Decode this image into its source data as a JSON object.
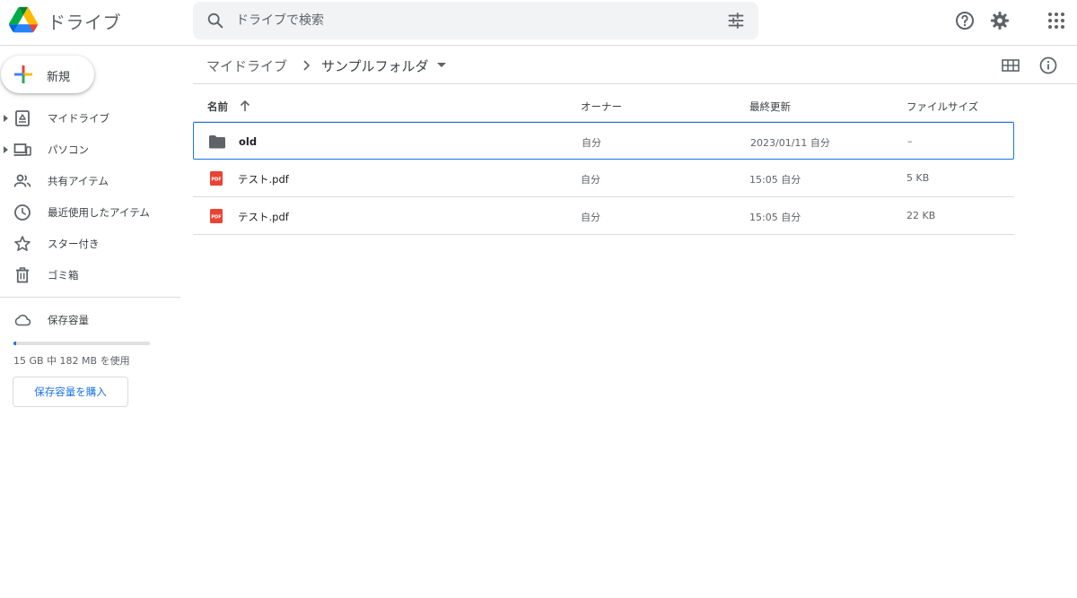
{
  "app": {
    "title": "ドライブ"
  },
  "search": {
    "placeholder": "ドライブで検索"
  },
  "sidebar": {
    "new_label": "新規",
    "items": [
      {
        "label": "マイドライブ",
        "icon": "my-drive-icon"
      },
      {
        "label": "パソコン",
        "icon": "computers-icon"
      },
      {
        "label": "共有アイテム",
        "icon": "shared-icon"
      },
      {
        "label": "最近使用したアイテム",
        "icon": "recent-icon"
      },
      {
        "label": "スター付き",
        "icon": "star-icon"
      },
      {
        "label": "ゴミ箱",
        "icon": "trash-icon"
      }
    ],
    "storage_label": "保存容量",
    "storage_text": "15 GB 中 182 MB を使用",
    "storage_used_fraction": 0.012,
    "buy_label": "保存容量を購入"
  },
  "breadcrumb": {
    "root": "マイドライブ",
    "current": "サンプルフォルダ"
  },
  "table": {
    "headers": {
      "name": "名前",
      "owner": "オーナー",
      "modified": "最終更新",
      "size": "ファイルサイズ"
    },
    "rows": [
      {
        "type": "folder",
        "name": "old",
        "owner": "自分",
        "modified": "2023/01/11 自分",
        "size": "–",
        "selected": true
      },
      {
        "type": "pdf",
        "name": "テスト.pdf",
        "owner": "自分",
        "modified": "15:05 自分",
        "size": "5 KB",
        "selected": false
      },
      {
        "type": "pdf",
        "name": "テスト.pdf",
        "owner": "自分",
        "modified": "15:05 自分",
        "size": "22 KB",
        "selected": false
      }
    ]
  },
  "colors": {
    "accent": "#1a73e8",
    "pdf_red": "#ea4335",
    "icon_gray": "#5f6368"
  }
}
